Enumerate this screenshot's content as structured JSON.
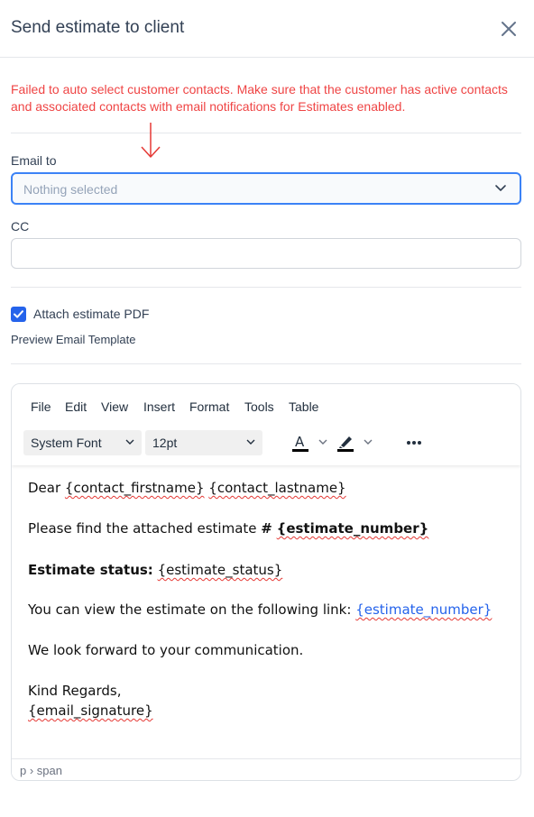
{
  "modal": {
    "title": "Send estimate to client",
    "close_icon": "close-icon"
  },
  "alert": {
    "message": "Failed to auto select customer contacts. Make sure that the customer has active contacts and associated contacts with email notifications for Estimates enabled.",
    "color": "#ef4444"
  },
  "annotation": {
    "icon": "arrow-down-icon",
    "color": "#e53935"
  },
  "email_to": {
    "label": "Email to",
    "placeholder": "Nothing selected",
    "icon": "chevron-down-icon"
  },
  "cc": {
    "label": "CC",
    "value": ""
  },
  "attach_pdf": {
    "label": "Attach estimate PDF",
    "checked": true
  },
  "preview": {
    "label": "Preview Email Template"
  },
  "editor": {
    "menu": [
      "File",
      "Edit",
      "View",
      "Insert",
      "Format",
      "Tools",
      "Table"
    ],
    "font_family": "System Font",
    "font_size": "12pt",
    "toolbar_icons": [
      "text-color-icon",
      "highlight-color-icon",
      "more-icon"
    ],
    "body": {
      "greeting_word": "Dear",
      "contact_firstname": "{contact_firstname}",
      "contact_lastname": "{contact_lastname}",
      "line2_prefix": "Please find the attached estimate",
      "line2_hash": "#",
      "estimate_number": "{estimate_number}",
      "status_label": "Estimate status:",
      "estimate_status": "{estimate_status}",
      "link_line_prefix": "You can view the estimate on the following link:",
      "link_text": "{estimate_number}",
      "closing": "We look forward to your communication.",
      "regards": "Kind Regards,",
      "signature": "{email_signature}"
    },
    "status_path": "p › span"
  },
  "colors": {
    "accent": "#3b82f6",
    "checkbox": "#2563eb",
    "link": "#2563eb"
  }
}
